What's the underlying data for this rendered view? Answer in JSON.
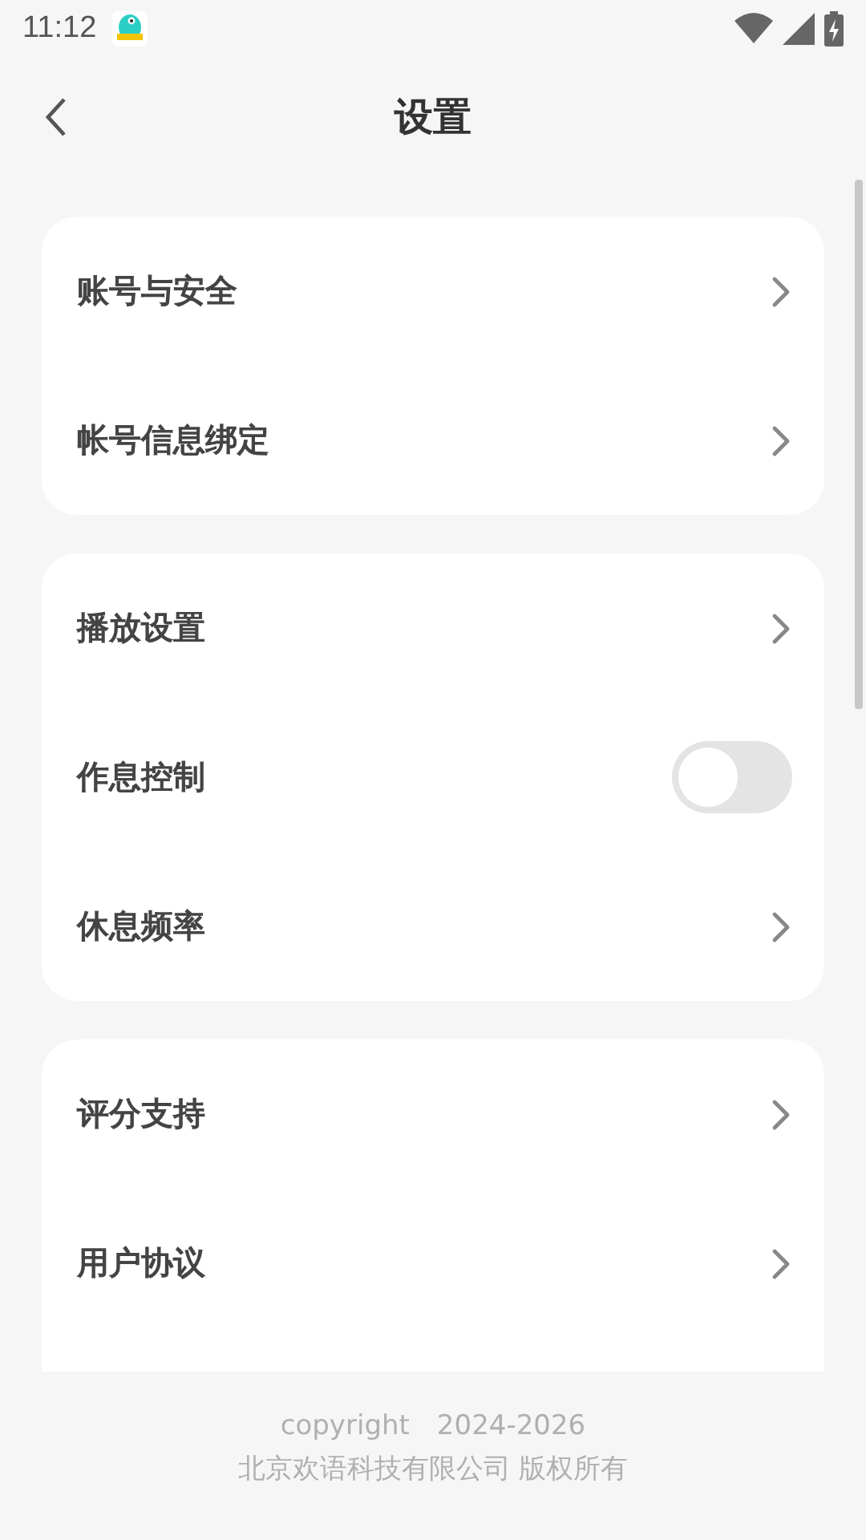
{
  "status_bar": {
    "time": "11:12"
  },
  "header": {
    "title": "设置"
  },
  "groups": [
    {
      "items": [
        {
          "label": "账号与安全",
          "kind": "link"
        },
        {
          "label": "帐号信息绑定",
          "kind": "link"
        }
      ]
    },
    {
      "items": [
        {
          "label": "播放设置",
          "kind": "link"
        },
        {
          "label": "作息控制",
          "kind": "toggle",
          "on": false
        },
        {
          "label": "休息频率",
          "kind": "link"
        }
      ]
    },
    {
      "items": [
        {
          "label": "评分支持",
          "kind": "link"
        },
        {
          "label": "用户协议",
          "kind": "link"
        }
      ]
    }
  ],
  "footer": {
    "copyright": "copyright　2024-2026",
    "company": "北京欢语科技有限公司 版权所有"
  }
}
